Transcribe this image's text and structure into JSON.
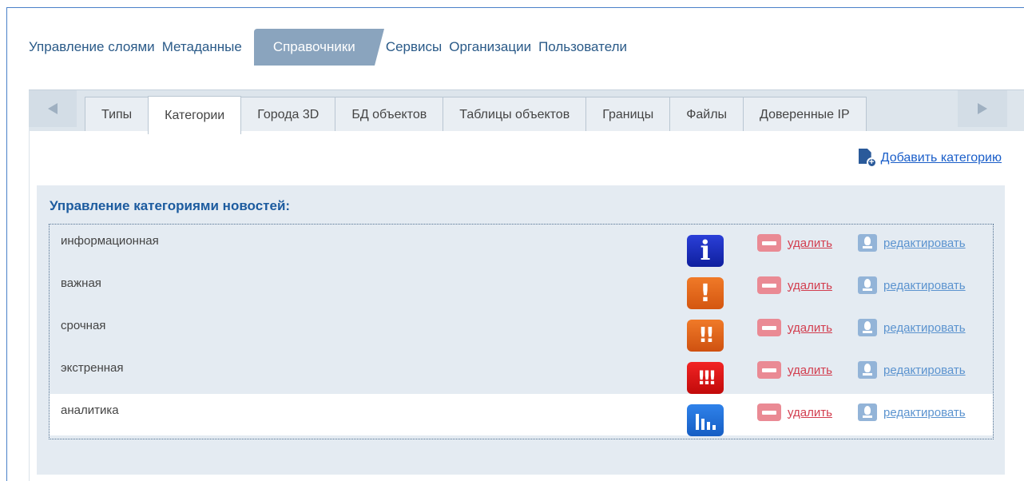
{
  "top_nav": {
    "items": [
      "Управление слоями",
      "Метаданные",
      "Справочники",
      "Сервисы",
      "Организации",
      "Пользователи"
    ],
    "active": "Справочники"
  },
  "tabs": {
    "items": [
      "Типы",
      "Категории",
      "Города 3D",
      "БД объектов",
      "Таблицы объектов",
      "Границы",
      "Файлы",
      "Доверенные IP"
    ],
    "active": "Категории"
  },
  "actions": {
    "add_category": "Добавить категорию"
  },
  "categories_section": {
    "title": "Управление категориями новостей:",
    "delete_label": "удалить",
    "edit_label": "редактировать",
    "rows": [
      {
        "name": "информационная",
        "badge": "i",
        "icon": "info-icon"
      },
      {
        "name": "важная",
        "badge": "!",
        "icon": "exclamation-icon"
      },
      {
        "name": "срочная",
        "badge": "!!",
        "icon": "double-exclamation-icon"
      },
      {
        "name": "экстренная",
        "badge": "!!!",
        "icon": "triple-exclamation-icon"
      },
      {
        "name": "аналитика",
        "badge": "",
        "icon": "bar-chart-icon"
      }
    ]
  },
  "colors": {
    "accent_blue": "#1c5b9f",
    "delete_red": "#d23d4e",
    "edit_blue": "#5b93cf",
    "active_tab_bg": "#8aa4be"
  }
}
